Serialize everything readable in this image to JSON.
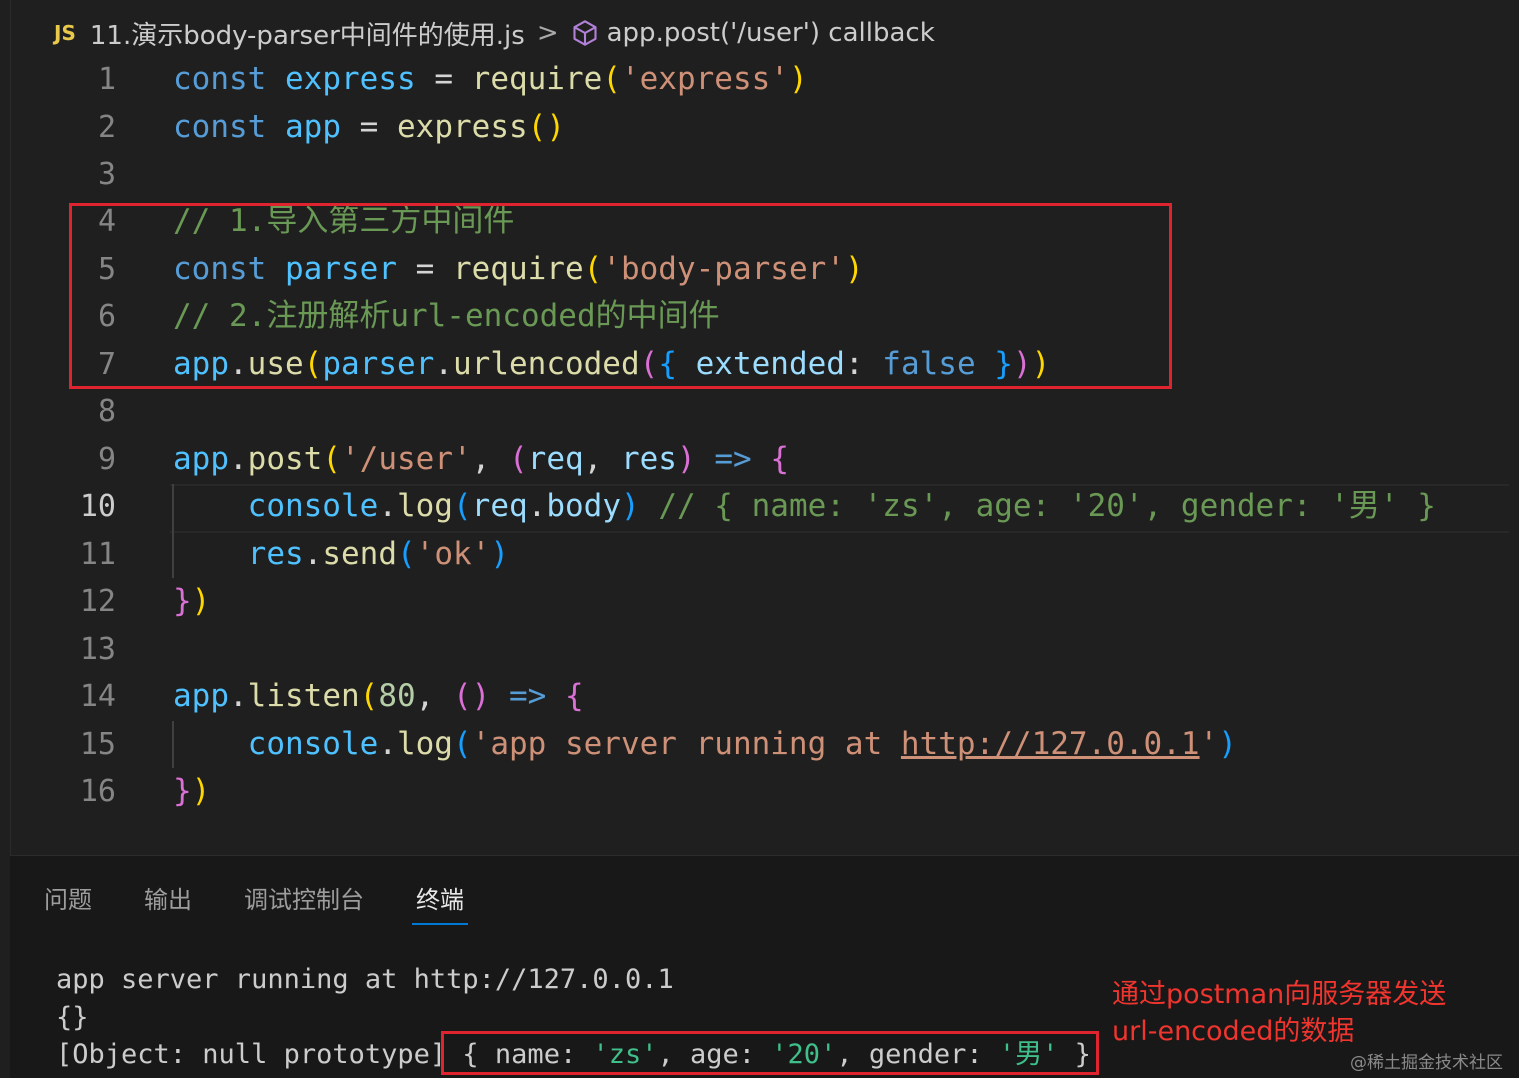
{
  "breadcrumb": {
    "file_icon": "JS",
    "file_name": "11.演示body-parser中间件的使用.js",
    "separator": ">",
    "symbol_icon": "cube-icon",
    "symbol": "app.post('/user') callback"
  },
  "code": {
    "line_numbers": [
      "1",
      "2",
      "3",
      "4",
      "5",
      "6",
      "7",
      "8",
      "9",
      "10",
      "11",
      "12",
      "13",
      "14",
      "15",
      "16"
    ],
    "active_line": "10",
    "lines": {
      "l1": {
        "kw": "const",
        "var": "express",
        "eq": " = ",
        "fn": "require",
        "p_open": "(",
        "str": "'express'",
        "p_close": ")"
      },
      "l2": {
        "kw": "const",
        "var": "app",
        "eq": " = ",
        "fn": "express",
        "parens": "()"
      },
      "l4": {
        "comment": "// 1.导入第三方中间件"
      },
      "l5": {
        "kw": "const",
        "var": "parser",
        "eq": " = ",
        "fn": "require",
        "p_open": "(",
        "str": "'body-parser'",
        "p_close": ")"
      },
      "l6": {
        "comment": "// 2.注册解析url-encoded的中间件"
      },
      "l7": {
        "obj": "app",
        "dot": ".",
        "fn": "use",
        "p_open": "(",
        "obj2": "parser",
        "dot2": ".",
        "fn2": "urlencoded",
        "p2_open": "(",
        "b_open": "{",
        "prop": " extended",
        "colon": ": ",
        "val": "false",
        "b_close": " }",
        "p2_close": ")",
        "p_close": ")"
      },
      "l9": {
        "obj": "app",
        "dot": ".",
        "fn": "post",
        "p_open": "(",
        "str": "'/user'",
        "comma": ", ",
        "a_open": "(",
        "arg1": "req",
        "sep": ", ",
        "arg2": "res",
        "a_close": ")",
        "arrow": " => ",
        "b_open": "{"
      },
      "l10": {
        "obj": "console",
        "dot": ".",
        "fn": "log",
        "p_open": "(",
        "arg": "req",
        "dot2": ".",
        "prop": "body",
        "p_close": ")",
        "comment": " // { name: 'zs', age: '20', gender: '男' }"
      },
      "l11": {
        "obj": "res",
        "dot": ".",
        "fn": "send",
        "p_open": "(",
        "str": "'ok'",
        "p_close": ")"
      },
      "l12": {
        "b_close": "}",
        "p_close": ")"
      },
      "l14": {
        "obj": "app",
        "dot": ".",
        "fn": "listen",
        "p_open": "(",
        "num": "80",
        "comma": ", ",
        "a_parens": "()",
        "arrow": " => ",
        "b_open": "{"
      },
      "l15": {
        "obj": "console",
        "dot": ".",
        "fn": "log",
        "p_open": "(",
        "str_a": "'app server running at ",
        "url": "http://127.0.0.1",
        "str_b": "'",
        "p_close": ")"
      },
      "l16": {
        "b_close": "}",
        "p_close": ")"
      }
    }
  },
  "panel": {
    "tabs": [
      "问题",
      "输出",
      "调试控制台",
      "终端"
    ],
    "active_tab": "终端"
  },
  "terminal": {
    "line1": "app server running at http://127.0.0.1",
    "line2": "{}",
    "line3_prefix": "[Object: null prototype]",
    "line3_obj": {
      "open": " { ",
      "k1": "name: ",
      "v1": "'zs'",
      "c1": ", ",
      "k2": "age: ",
      "v2": "'20'",
      "c2": ", ",
      "k3": "gender: ",
      "v3": "'男'",
      "close": " }"
    }
  },
  "annotation": {
    "line1": "通过postman向服务器发送",
    "line2": "url-encoded的数据"
  },
  "watermark": "@稀土掘金技术社区",
  "colors": {
    "editor_bg": "#1f1f1f",
    "panel_bg": "#181818",
    "highlight_box": "#e0242f",
    "keyword": "#569cd6",
    "function": "#dcdcaa",
    "string": "#ce9178",
    "comment": "#6a9955"
  }
}
